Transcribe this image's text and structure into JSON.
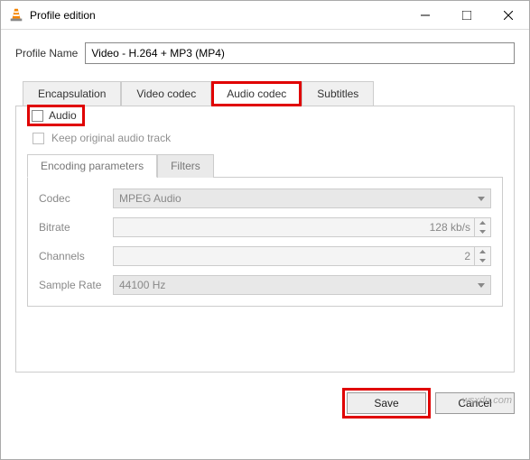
{
  "window": {
    "title": "Profile edition"
  },
  "profile": {
    "name_label": "Profile Name",
    "name_value": "Video - H.264 + MP3 (MP4)"
  },
  "tabs": {
    "encapsulation": "Encapsulation",
    "video_codec": "Video codec",
    "audio_codec": "Audio codec",
    "subtitles": "Subtitles"
  },
  "audio": {
    "group_label": "Audio",
    "keep_original": "Keep original audio track",
    "subtabs": {
      "encoding": "Encoding parameters",
      "filters": "Filters"
    },
    "codec_label": "Codec",
    "codec_value": "MPEG Audio",
    "bitrate_label": "Bitrate",
    "bitrate_value": "128 kb/s",
    "channels_label": "Channels",
    "channels_value": "2",
    "samplerate_label": "Sample Rate",
    "samplerate_value": "44100 Hz"
  },
  "buttons": {
    "save": "Save",
    "cancel": "Cancel"
  },
  "watermark": "wsxdn.com"
}
